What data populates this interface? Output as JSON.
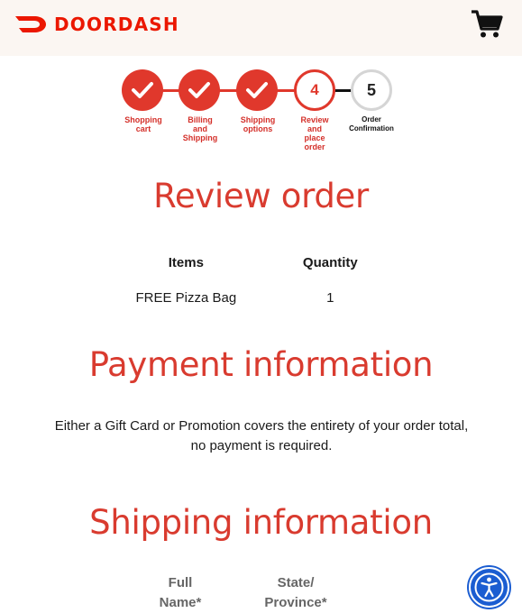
{
  "header": {
    "logo_text": "DOORDASH",
    "icons": {
      "logo": "doordash-logo-icon",
      "cart": "shopping-cart-icon"
    }
  },
  "steps": [
    {
      "number": "1",
      "label_lines": [
        "Shopping",
        "cart"
      ],
      "status": "done"
    },
    {
      "number": "2",
      "label_lines": [
        "Billing",
        "and",
        "Shipping"
      ],
      "status": "done"
    },
    {
      "number": "3",
      "label_lines": [
        "Shipping",
        "options"
      ],
      "status": "done"
    },
    {
      "number": "4",
      "label_lines": [
        "Review",
        "and",
        "place",
        "order"
      ],
      "status": "current"
    },
    {
      "number": "5",
      "label_lines": [
        "Order",
        "Confirmation"
      ],
      "status": "future"
    }
  ],
  "review": {
    "title": "Review order",
    "columns": [
      "Items",
      "Quantity"
    ],
    "rows": [
      {
        "item": "FREE Pizza Bag",
        "quantity": "1"
      }
    ]
  },
  "payment": {
    "title": "Payment information",
    "message": "Either a Gift Card or Promotion covers the entirety of your order total, no payment is required."
  },
  "shipping": {
    "title": "Shipping information",
    "columns": [
      {
        "line1": "Full",
        "line2": "Name*"
      },
      {
        "line1": "State/",
        "line2": "Province*"
      }
    ]
  },
  "accessibility": {
    "icon": "accessibility-icon"
  },
  "colors": {
    "brand": "#eb1700",
    "accent": "#e0382c",
    "title": "#d93b2f",
    "header_bg": "#fbf6f2",
    "a11y_blue": "#1b5dd1"
  }
}
